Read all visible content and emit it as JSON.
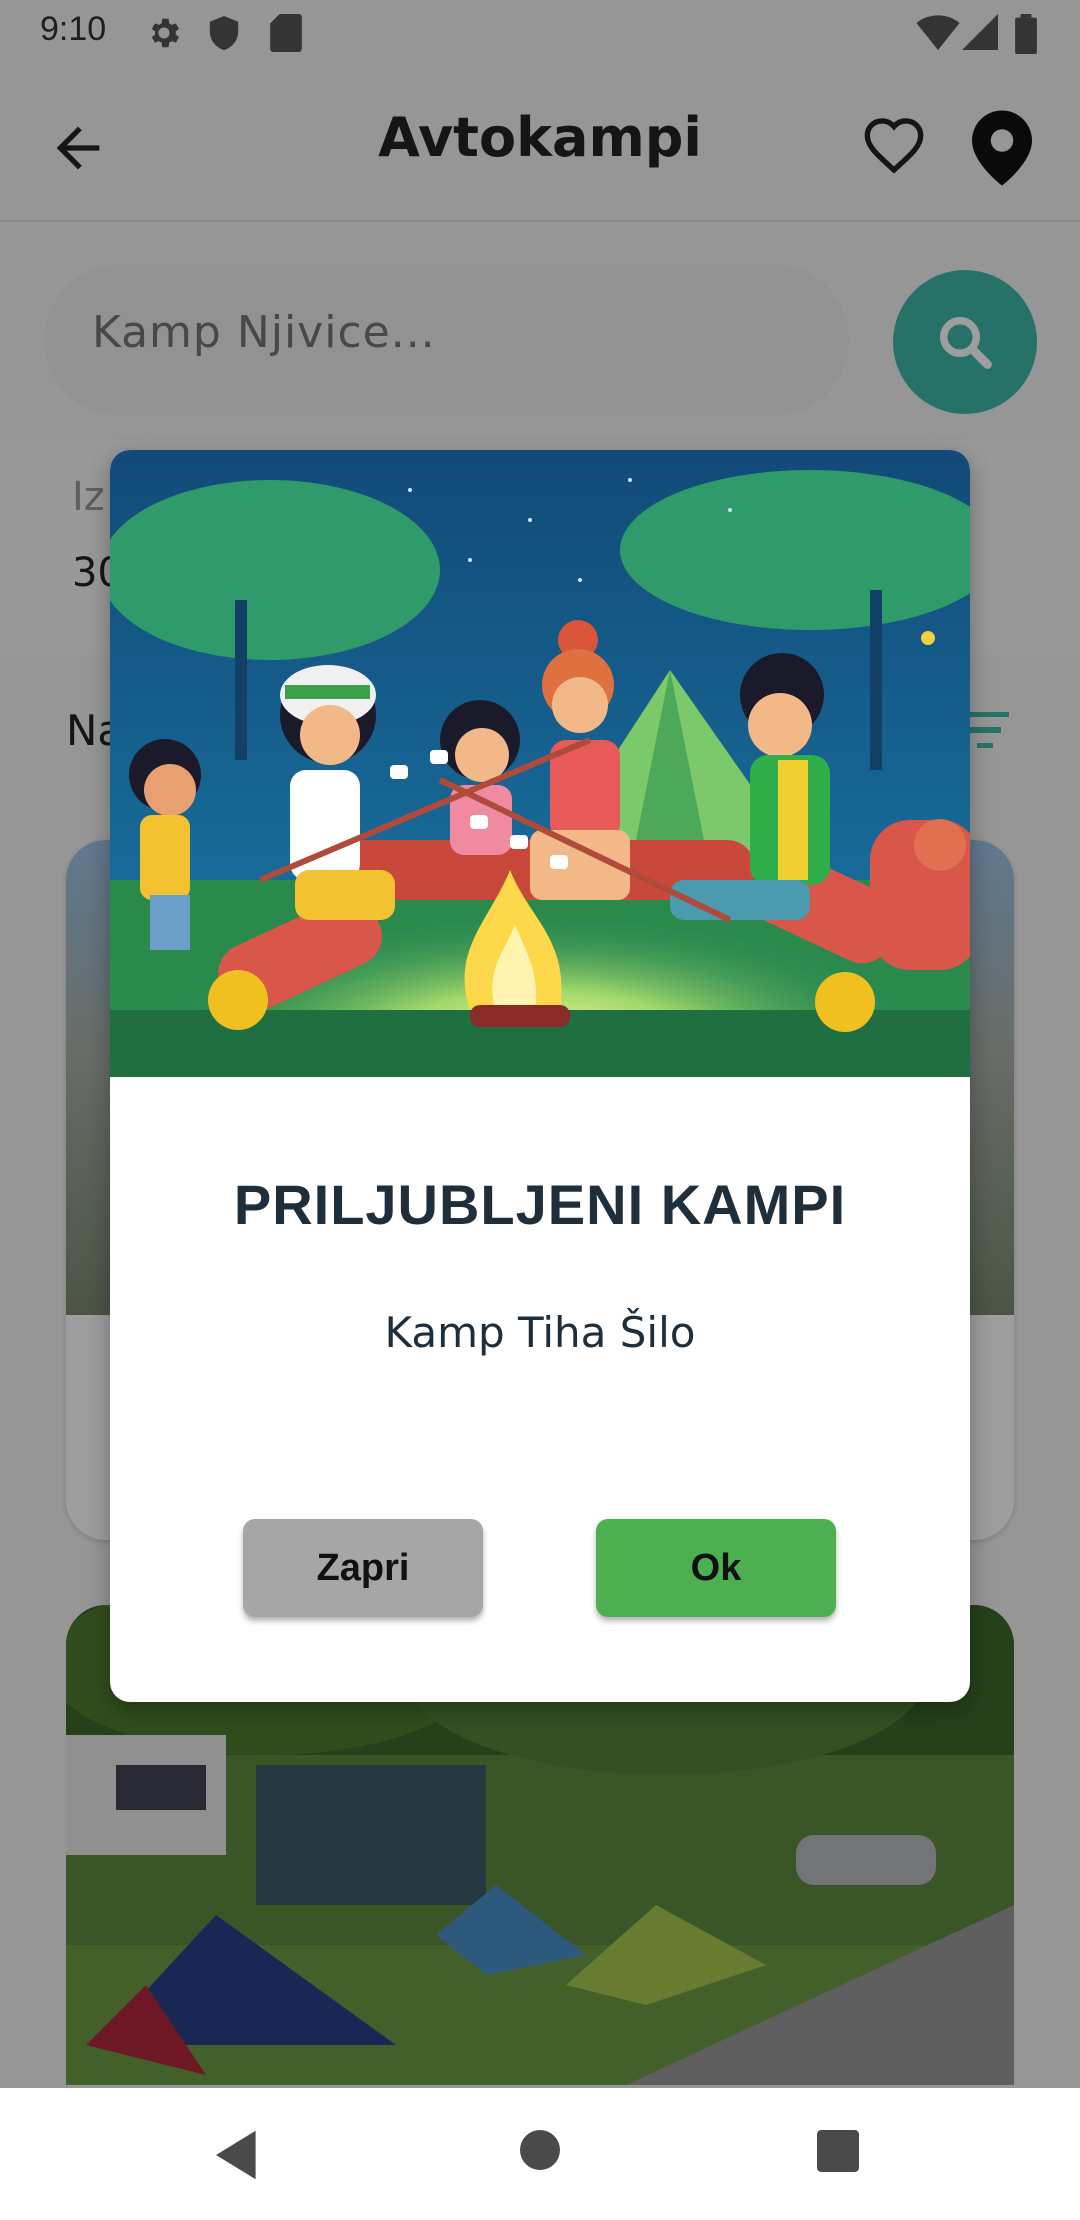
{
  "status_bar": {
    "time": "9:10"
  },
  "app_bar": {
    "title": "Avtokampi"
  },
  "search": {
    "placeholder": "Kamp Njivice..."
  },
  "filters": {
    "label_partial": "Iz",
    "value_partial": "30"
  },
  "sort": {
    "label_partial": "Na"
  },
  "dialog": {
    "title": "PRILJUBLJENI KAMPI",
    "message": "Kamp Tiha Šilo",
    "close_label": "Zapri",
    "ok_label": "Ok"
  },
  "colors": {
    "accent": "#3fb8a8",
    "ok_button": "#4caf50",
    "close_button": "#a6a6a6",
    "title_text": "#1e2e3a"
  },
  "icons": {
    "back": "arrow-left-icon",
    "favorites": "heart-icon",
    "map": "location-pin-icon",
    "search": "search-icon",
    "sort": "sort-icon"
  }
}
